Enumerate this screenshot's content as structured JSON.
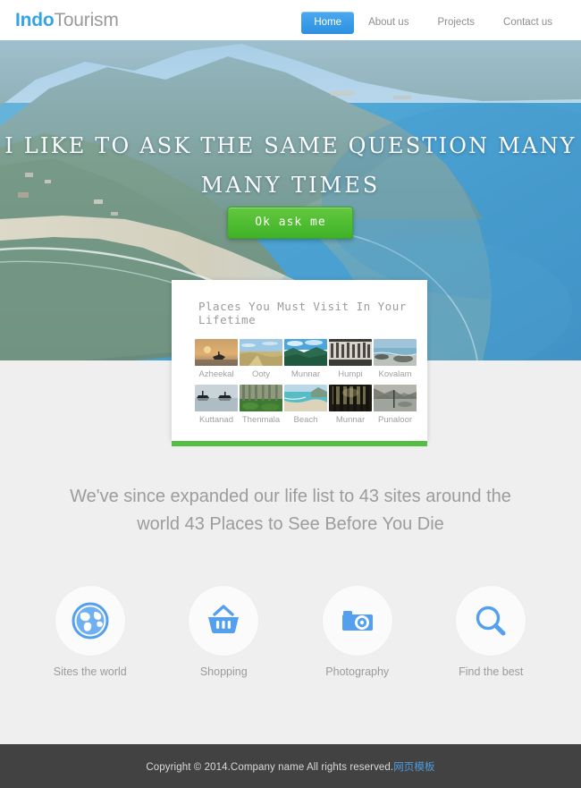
{
  "header": {
    "logo_primary": "Indo",
    "logo_secondary": "Tourism",
    "nav": [
      {
        "label": "Home",
        "active": true
      },
      {
        "label": "About us",
        "active": false
      },
      {
        "label": "Projects",
        "active": false
      },
      {
        "label": "Contact us",
        "active": false
      }
    ]
  },
  "hero": {
    "title_line1": "I LIKE TO ASK THE SAME QUESTION MANY",
    "title_line2": "MANY TIMES",
    "button_label": "Ok ask me"
  },
  "card": {
    "title": "Places You Must Visit In Your Lifetime",
    "row1": [
      {
        "caption": "Azheekal"
      },
      {
        "caption": "Ooty"
      },
      {
        "caption": "Munnar"
      },
      {
        "caption": "Humpi"
      },
      {
        "caption": "Kovalam"
      }
    ],
    "row2": [
      {
        "caption": "Kuttanad"
      },
      {
        "caption": "Thenmala"
      },
      {
        "caption": "Beach"
      },
      {
        "caption": "Munnar"
      },
      {
        "caption": "Punaloor"
      }
    ]
  },
  "intro": {
    "text": "We've since expanded our life list to 43 sites around the world 43 Places to See Before You Die"
  },
  "features": [
    {
      "label": "Sites the world",
      "icon": "globe-icon"
    },
    {
      "label": "Shopping",
      "icon": "shopping-basket-icon"
    },
    {
      "label": "Photography",
      "icon": "camera-icon"
    },
    {
      "label": "Find the best",
      "icon": "magnifier-icon"
    }
  ],
  "footer": {
    "copyright": "Copyright © 2014.Company name All rights reserved.",
    "link_label": "网页模板"
  },
  "colors": {
    "accent_blue": "#34a3e8",
    "nav_active": "#2e8fe0",
    "green": "#53be43",
    "footer_bg": "#424242",
    "page_bg": "#efefef"
  }
}
